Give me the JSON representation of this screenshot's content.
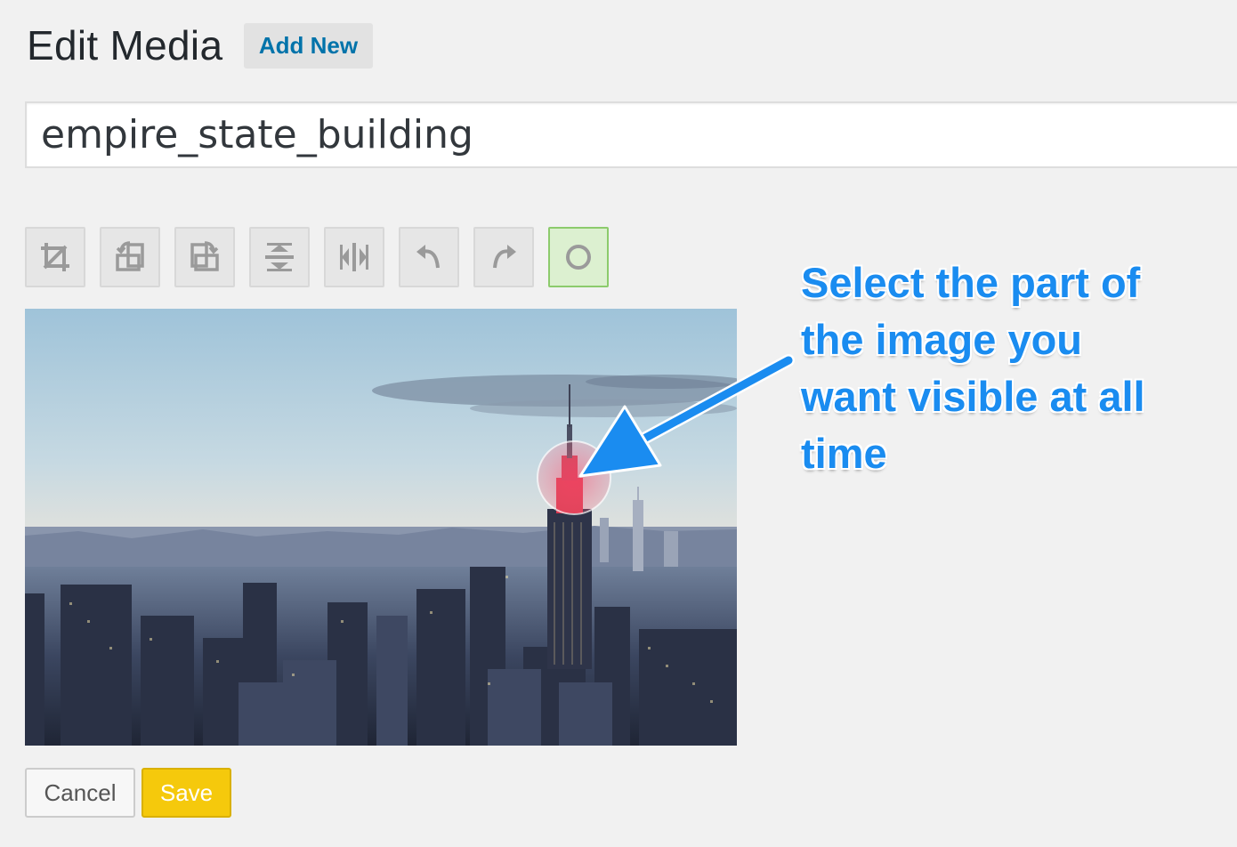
{
  "header": {
    "title": "Edit Media",
    "add_new_label": "Add New"
  },
  "title_field": {
    "value": "empire_state_building"
  },
  "toolbar": {
    "tools": [
      {
        "name": "crop-icon"
      },
      {
        "name": "rotate-left-icon"
      },
      {
        "name": "rotate-right-icon"
      },
      {
        "name": "flip-vertical-icon"
      },
      {
        "name": "flip-horizontal-icon"
      },
      {
        "name": "undo-icon"
      },
      {
        "name": "redo-icon"
      },
      {
        "name": "focal-point-icon",
        "active": true
      }
    ]
  },
  "annotation": {
    "lines": [
      "Select the part of",
      "the image you",
      "want visible at all",
      "time"
    ]
  },
  "actions": {
    "cancel_label": "Cancel",
    "save_label": "Save"
  },
  "colors": {
    "link": "#0073aa",
    "save_button": "#f5c90c",
    "annotation": "#1a8cf0",
    "active_tool": "#dcf0d0"
  }
}
